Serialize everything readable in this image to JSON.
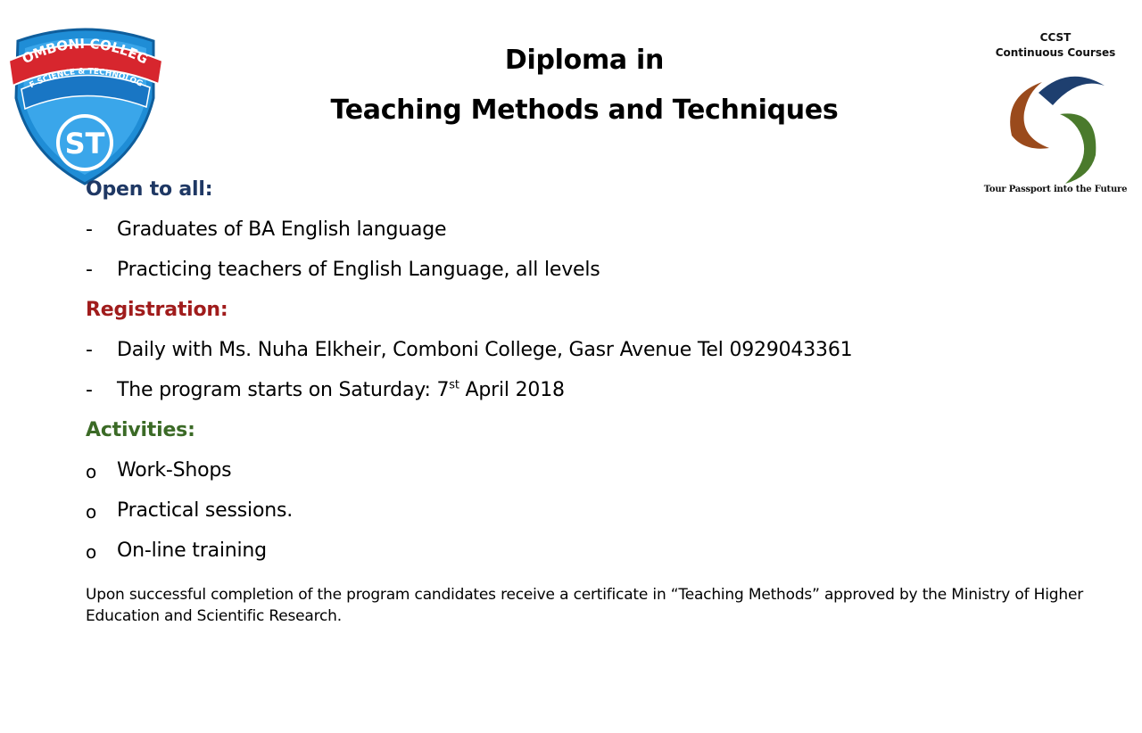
{
  "logos": {
    "left": {
      "name_line1": "COMBONI COLLEGE",
      "name_line2": "OF SCIENCE & TECHNOLOGY",
      "monogram": "ST"
    },
    "right": {
      "title_line1": "CCST",
      "title_line2": "Continuous Courses",
      "tagline": "Tour Passport into the Future"
    }
  },
  "title": {
    "line1": "Diploma in",
    "line2": "Teaching Methods and Techniques"
  },
  "sections": {
    "open": {
      "heading": "Open to all",
      "heading_colon": ":",
      "items": [
        {
          "marker": "-",
          "text": "Graduates of BA English language"
        },
        {
          "marker": "-",
          "text": "Practicing teachers of English Language, all levels"
        }
      ]
    },
    "registration": {
      "heading": "Registration:",
      "items": [
        {
          "marker": "-",
          "text": "Daily with Ms. Nuha Elkheir, Comboni College, Gasr Avenue Tel 0929043361"
        },
        {
          "marker": "-",
          "text_before": "The program starts on Saturday: 7",
          "superscript": "st",
          "text_after": " April 2018"
        }
      ]
    },
    "activities": {
      "heading": "Activities:",
      "items": [
        {
          "marker": "o",
          "text": "Work-Shops"
        },
        {
          "marker": "o",
          "text": "Practical sessions."
        },
        {
          "marker": "o",
          "text": "On-line training"
        }
      ]
    }
  },
  "footer_note": "Upon successful completion of the program candidates receive a certificate in “Teaching Methods” approved by the Ministry of Higher Education and Scientific Research.",
  "colors": {
    "open_heading": "#1f3864",
    "registration_heading": "#a01c1c",
    "activities_heading": "#3b6a26",
    "shield_blue": "#1f8dd6",
    "shield_red": "#d7262e",
    "swirl_navy": "#1e3f6f",
    "swirl_brown": "#9a4a1c",
    "swirl_green": "#4a7a2c"
  }
}
